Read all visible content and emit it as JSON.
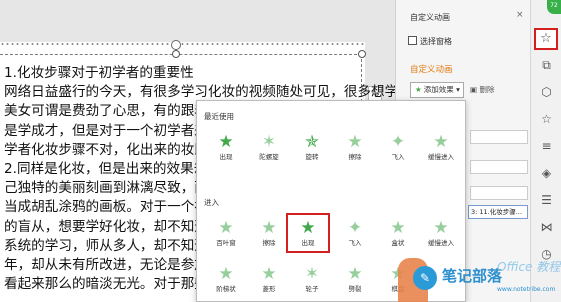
{
  "document": {
    "lines": [
      "1.化妆步骤对于初学者的重要性",
      "网络日益盛行的今天，有很多学习化妆的视频随处可见，很多想学化妆",
      "美女可谓是费劲了心思，有的跟着网上",
      "是学成才，但是对于一个初学者来学，",
      "学者化妆步骤不对，化出来的妆即就可",
      "2.同样是化妆，但是出来的效果却是千差",
      "己独特的美丽刻画到淋漓尽致，而一个",
      "当成胡乱涂鸦的画板。对于一个初学化",
      "的盲从，想要学好化妆，却不知道从何",
      "系统的学习，师从多人，却不知道为什",
      "年，却从未有所改进，无论是参加聚会",
      "看起来那么的暗淡无光。对于那些精"
    ],
    "edit_tab": "✎"
  },
  "task_pane": {
    "title": "自定义动画",
    "close": "×",
    "select_pane_label": "选择窗格",
    "custom_animation_heading": "自定义动画",
    "add_effect_button": "添加效果",
    "delete_button": "删除",
    "list_item": "3: 11.化妆步骤..."
  },
  "effects_popup": {
    "recent_label": "最近使用",
    "recent_effects": [
      "出现",
      "陀螺旋",
      "旋转",
      "擦除",
      "飞入",
      "缓慢进入"
    ],
    "entrance_label": "进入",
    "entrance_effects": [
      "百叶窗",
      "擦除",
      "出现",
      "飞入",
      "盒状",
      "缓慢进入"
    ],
    "more_effects": [
      "阶梯状",
      "菱形",
      "轮子",
      "劈裂",
      "棋盘"
    ],
    "selected_effect": "出现"
  },
  "toolbar": {
    "active_icon": "star-icon",
    "icons": [
      "copy-icon",
      "shapes-icon",
      "star-outline-icon",
      "sliders-icon",
      "layers-icon",
      "list-icon",
      "table-icon",
      "share-icon",
      "clock-icon"
    ],
    "badge": "72"
  },
  "watermark": {
    "text": "笔记部落",
    "brand": "Office 教程网",
    "url": "www.notetribe.com"
  },
  "colors": {
    "accent_orange": "#e07a10",
    "effect_green": "#41a94a",
    "highlight_red": "#d21f1f",
    "watermark_blue": "#2d8fcf"
  }
}
